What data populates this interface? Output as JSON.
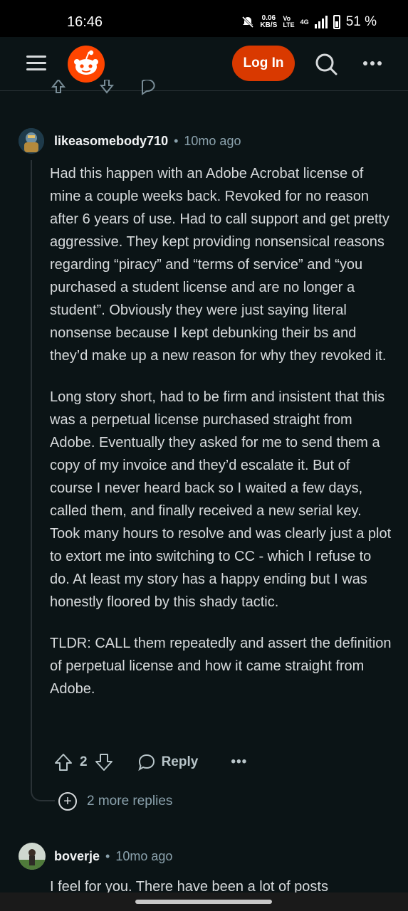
{
  "status_bar": {
    "time": "16:46",
    "speed_value": "0.06",
    "speed_unit": "KB/S",
    "volte_top": "Vo",
    "volte_bottom": "LTE",
    "network": "4G",
    "battery": "51 %"
  },
  "header": {
    "login_label": "Log In",
    "icons": [
      "menu-icon",
      "reddit-logo",
      "search-icon",
      "more-icon"
    ],
    "login_color": "#d93900"
  },
  "comment": {
    "username": "likeasomebody710",
    "separator": "•",
    "time_ago": "10mo ago",
    "paragraphs": [
      "Had this happen with an Adobe Acrobat license of mine a couple weeks back. Revoked for no reason after 6 years of use. Had to call support and get pretty aggressive. They kept providing nonsensical reasons regarding “piracy” and “terms of service” and “you purchased a student license and are no longer a student”. Obviously they were just saying literal nonsense because I kept debunking their bs and they’d make up a new reason for why they revoked it.",
      "Long story short, had to be firm and insistent that this was a perpetual license purchased straight from Adobe. Eventually they asked for me to send them a copy of my invoice and they’d escalate it. But of course I never heard back so I waited a few days, called them, and finally received a new serial key. Took many hours to resolve and was clearly just a plot to extort me into switching to CC - which I refuse to do. At least my story has a happy ending but I was honestly floored by this shady tactic.",
      "TLDR: CALL them repeatedly and assert the definition of perpetual license and how it came straight from Adobe."
    ],
    "score": "2",
    "reply_label": "Reply",
    "more_label": "•••"
  },
  "more_replies": {
    "label": "2 more replies"
  },
  "second_comment": {
    "username": "boverje",
    "separator": "•",
    "time_ago": "10mo ago",
    "preview": "I feel for you. There have been a lot of posts"
  }
}
